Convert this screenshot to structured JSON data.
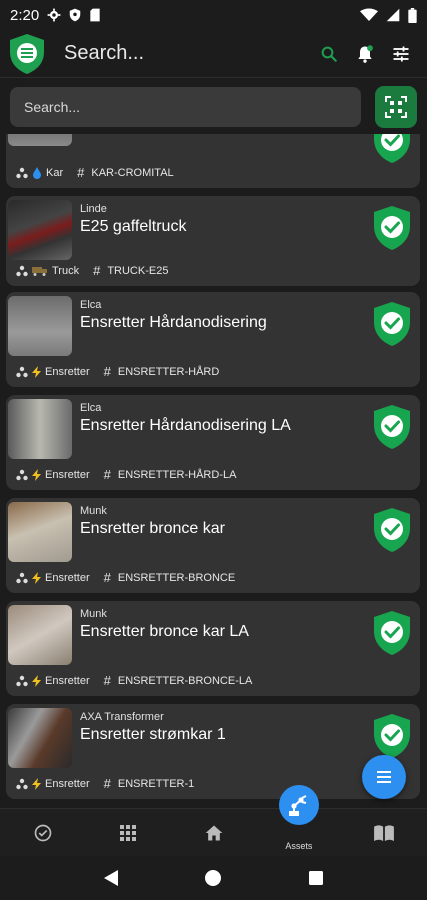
{
  "status_bar": {
    "time": "2:20"
  },
  "app_bar": {
    "title": "Search...",
    "accent": "#1fa050"
  },
  "search": {
    "placeholder": "Search..."
  },
  "colors": {
    "card_bg": "#333333",
    "shield": "#17a64f",
    "fab": "#2d8ff0"
  },
  "cards": [
    {
      "brand": "",
      "name": "",
      "type_icon": "drop-icon",
      "type": "Kar",
      "tag": "KAR-CROMITAL",
      "status": "ok"
    },
    {
      "brand": "Linde",
      "name": "E25 gaffeltruck",
      "type_icon": "truck-icon",
      "type": "Truck",
      "tag": "TRUCK-E25",
      "status": "ok"
    },
    {
      "brand": "Elca",
      "name": "Ensretter Hårdanodisering",
      "type_icon": "bolt-icon",
      "type": "Ensretter",
      "tag": "ENSRETTER-HÅRD",
      "status": "ok"
    },
    {
      "brand": "Elca",
      "name": "Ensretter Hårdanodisering LA",
      "type_icon": "bolt-icon",
      "type": "Ensretter",
      "tag": "ENSRETTER-HÅRD-LA",
      "status": "ok"
    },
    {
      "brand": "Munk",
      "name": "Ensretter bronce kar",
      "type_icon": "bolt-icon",
      "type": "Ensretter",
      "tag": "ENSRETTER-BRONCE",
      "status": "ok"
    },
    {
      "brand": "Munk",
      "name": "Ensretter bronce kar LA",
      "type_icon": "bolt-icon",
      "type": "Ensretter",
      "tag": "ENSRETTER-BRONCE-LA",
      "status": "ok"
    },
    {
      "brand": "AXA Transformer",
      "name": "Ensretter strømkar 1",
      "type_icon": "bolt-icon",
      "type": "Ensretter",
      "tag": "ENSRETTER-1",
      "status": "ok"
    }
  ],
  "bottom_nav": {
    "items": [
      {
        "icon": "check-circle-icon",
        "label": ""
      },
      {
        "icon": "grid-icon",
        "label": ""
      },
      {
        "icon": "home-icon",
        "label": ""
      },
      {
        "icon": "robot-arm-icon",
        "label": "Assets",
        "active": true
      },
      {
        "icon": "book-icon",
        "label": ""
      }
    ]
  }
}
